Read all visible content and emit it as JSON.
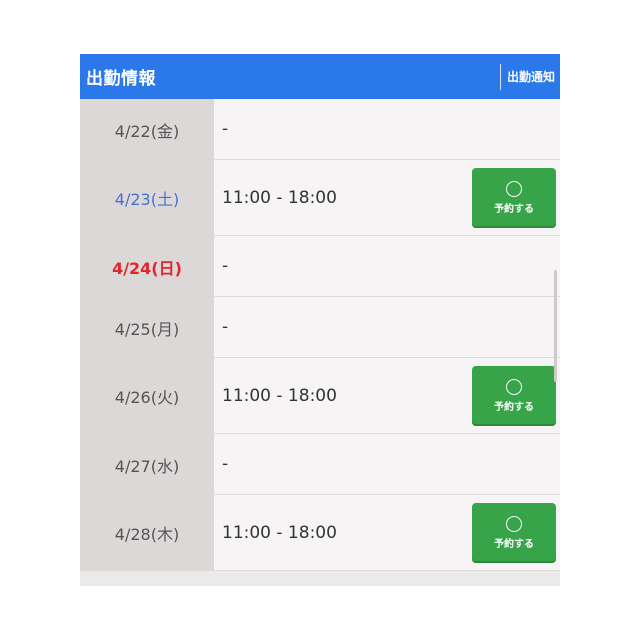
{
  "header": {
    "title": "出勤情報",
    "notify_label": "出勤通知"
  },
  "schedule": [
    {
      "date": "4/22(金)",
      "day_type": "weekday",
      "time": "-",
      "reserve_label": ""
    },
    {
      "date": "4/23(土)",
      "day_type": "saturday",
      "time": "11:00 - 18:00",
      "reserve_label": "予約する"
    },
    {
      "date": "4/24(日)",
      "day_type": "sunday",
      "time": "-",
      "reserve_label": ""
    },
    {
      "date": "4/25(月)",
      "day_type": "weekday",
      "time": "-",
      "reserve_label": ""
    },
    {
      "date": "4/26(火)",
      "day_type": "weekday",
      "time": "11:00 - 18:00",
      "reserve_label": "予約する"
    },
    {
      "date": "4/27(水)",
      "day_type": "weekday",
      "time": "-",
      "reserve_label": ""
    },
    {
      "date": "4/28(木)",
      "day_type": "weekday",
      "time": "11:00 - 18:00",
      "reserve_label": "予約する"
    }
  ],
  "colors": {
    "header_bg": "#2a78ea",
    "reserve_button": "#37a449",
    "saturday_text": "#4a6fd0",
    "sunday_text": "#e0262a"
  },
  "icons": {
    "reserve": "circle-icon"
  }
}
